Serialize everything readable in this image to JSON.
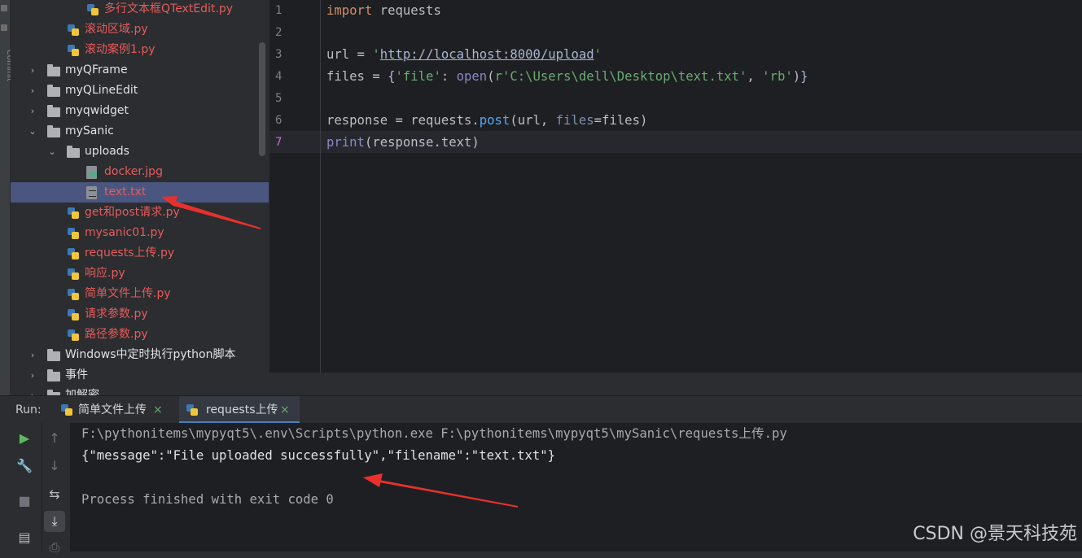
{
  "leftstrip": {
    "vertical_label": "Commit"
  },
  "tree": {
    "items": [
      {
        "label": "多行文本框QTextEdit.py",
        "type": "py",
        "indent": 4,
        "status": "error"
      },
      {
        "label": "滚动区域.py",
        "type": "py",
        "indent": 3,
        "status": "error"
      },
      {
        "label": "滚动案例1.py",
        "type": "py",
        "indent": 3,
        "status": "error"
      },
      {
        "label": "myQFrame",
        "type": "folder",
        "indent": 2,
        "expanded": false
      },
      {
        "label": "myQLineEdit",
        "type": "folder",
        "indent": 2,
        "expanded": false
      },
      {
        "label": "myqwidget",
        "type": "folder",
        "indent": 2,
        "expanded": false
      },
      {
        "label": "mySanic",
        "type": "folder",
        "indent": 2,
        "expanded": true
      },
      {
        "label": "uploads",
        "type": "folder",
        "indent": 3,
        "expanded": true
      },
      {
        "label": "docker.jpg",
        "type": "img",
        "indent": 4,
        "status": "error"
      },
      {
        "label": "text.txt",
        "type": "txt",
        "indent": 4,
        "status": "error",
        "selected": true
      },
      {
        "label": "get和post请求.py",
        "type": "py",
        "indent": 3,
        "status": "error"
      },
      {
        "label": "mysanic01.py",
        "type": "py",
        "indent": 3,
        "status": "error"
      },
      {
        "label": "requests上传.py",
        "type": "py",
        "indent": 3,
        "status": "error"
      },
      {
        "label": "响应.py",
        "type": "py",
        "indent": 3,
        "status": "error"
      },
      {
        "label": "简单文件上传.py",
        "type": "py",
        "indent": 3,
        "status": "error"
      },
      {
        "label": "请求参数.py",
        "type": "py",
        "indent": 3,
        "status": "error"
      },
      {
        "label": "路径参数.py",
        "type": "py",
        "indent": 3,
        "status": "error"
      },
      {
        "label": "Windows中定时执行python脚本",
        "type": "folder",
        "indent": 2,
        "expanded": false
      },
      {
        "label": "事件",
        "type": "folder",
        "indent": 2,
        "expanded": false
      },
      {
        "label": "加解密",
        "type": "folder",
        "indent": 2,
        "expanded": false
      }
    ]
  },
  "editor": {
    "line_numbers": [
      "1",
      "2",
      "3",
      "4",
      "5",
      "6",
      "7"
    ],
    "current_line": 7,
    "lines": [
      [
        {
          "t": "import",
          "c": "kw"
        },
        {
          "t": " requests",
          "c": ""
        }
      ],
      [],
      [
        {
          "t": "url = ",
          "c": ""
        },
        {
          "t": "'",
          "c": "str"
        },
        {
          "t": "http://localhost:8000/upload",
          "c": "link"
        },
        {
          "t": "'",
          "c": "str"
        }
      ],
      [
        {
          "t": "files = ",
          "c": ""
        },
        {
          "t": "{",
          "c": "brace"
        },
        {
          "t": "'file'",
          "c": "str"
        },
        {
          "t": ": ",
          "c": ""
        },
        {
          "t": "open",
          "c": "builtin"
        },
        {
          "t": "(",
          "c": ""
        },
        {
          "t": "r'C:\\Users\\dell\\Desktop\\text.txt'",
          "c": "str"
        },
        {
          "t": ", ",
          "c": ""
        },
        {
          "t": "'rb'",
          "c": "str"
        },
        {
          "t": ")",
          "c": ""
        },
        {
          "t": "}",
          "c": "brace"
        }
      ],
      [],
      [
        {
          "t": "response = requests.",
          "c": ""
        },
        {
          "t": "post",
          "c": "fn"
        },
        {
          "t": "(url, ",
          "c": ""
        },
        {
          "t": "files",
          "c": "param"
        },
        {
          "t": "=files)",
          "c": ""
        }
      ],
      [
        {
          "t": "print",
          "c": "builtin"
        },
        {
          "t": "(response.text)",
          "c": ""
        }
      ]
    ]
  },
  "run": {
    "label": "Run:",
    "tabs": [
      {
        "label": "简单文件上传",
        "active": false
      },
      {
        "label": "requests上传",
        "active": true
      }
    ],
    "close_glyph": "×"
  },
  "console": {
    "lines": [
      {
        "text": "F:\\pythonitems\\mypyqt5\\.env\\Scripts\\python.exe F:\\pythonitems\\mypyqt5\\mySanic\\requests上传.py",
        "kind": "cmd"
      },
      {
        "text": "{\"message\":\"File uploaded successfully\",\"filename\":\"text.txt\"}",
        "kind": "out"
      },
      {
        "text": "",
        "kind": "out"
      },
      {
        "text": "Process finished with exit code 0",
        "kind": "fin"
      }
    ]
  },
  "toolbar": {
    "icons": [
      "play-icon",
      "up-arrow-icon",
      "wrench-icon",
      "down-arrow-icon",
      "stop-icon",
      "soft-wrap-icon",
      "scroll-to-end-icon",
      "layout-icon",
      "print-icon"
    ]
  },
  "watermark": "CSDN @景天科技苑",
  "colors": {
    "accent": "#4a7fc1",
    "error_text": "#e65c5c",
    "annotation_arrow": "#e8312c",
    "selection": "#4a5680"
  }
}
